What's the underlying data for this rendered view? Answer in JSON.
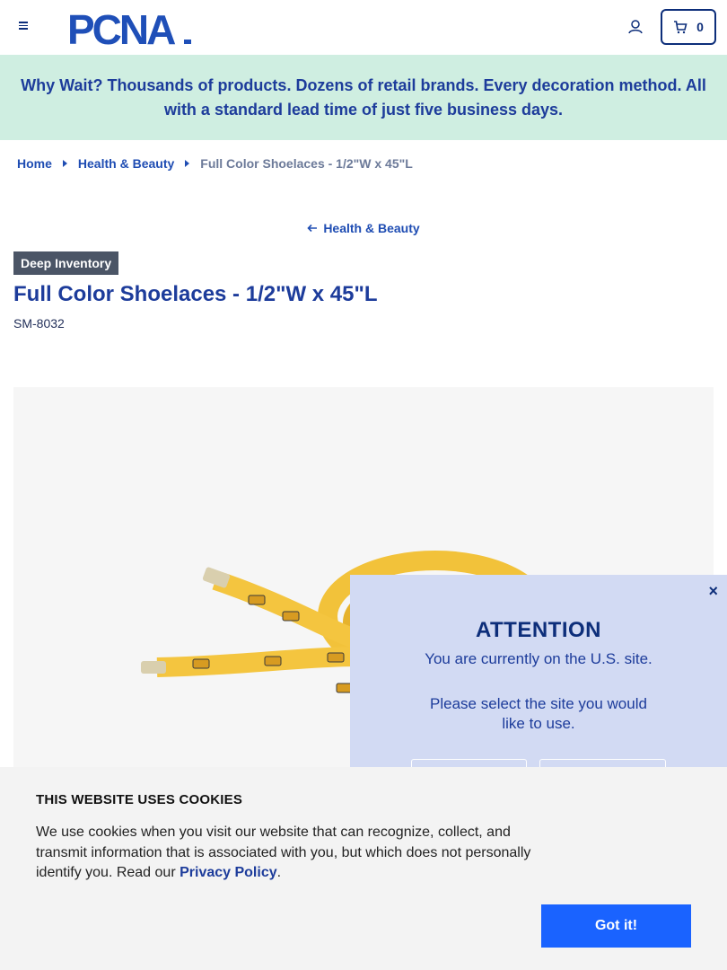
{
  "header": {
    "logo_text": "PCNA",
    "cart_count": "0"
  },
  "promo": {
    "text": "Why Wait? Thousands of products. Dozens of retail brands. Every decoration method. All with a standard lead time of just five business days."
  },
  "breadcrumb": {
    "items": [
      "Home",
      "Health & Beauty"
    ],
    "current": "Full Color Shoelaces - 1/2\"W x 45\"L"
  },
  "back_link": "Health & Beauty",
  "product": {
    "badge": "Deep Inventory",
    "title": "Full Color Shoelaces - 1/2\"W x 45\"L",
    "sku": "SM-8032"
  },
  "attention": {
    "close": "×",
    "title": "ATTENTION",
    "message": "You are currently on the U.S. site.",
    "sub": "Please select the site you would like to use."
  },
  "cookie": {
    "title": "THIS WEBSITE USES COOKIES",
    "text": "We use cookies when you visit our website that can recognize, collect, and transmit information that is associated with you, but which does not personally identify you. Read our ",
    "link": "Privacy Policy",
    "end": ".",
    "button": "Got it!"
  },
  "colors": {
    "brand": "#1d3c9b",
    "promo_bg": "#cfeee1",
    "cta": "#1a63ff"
  }
}
